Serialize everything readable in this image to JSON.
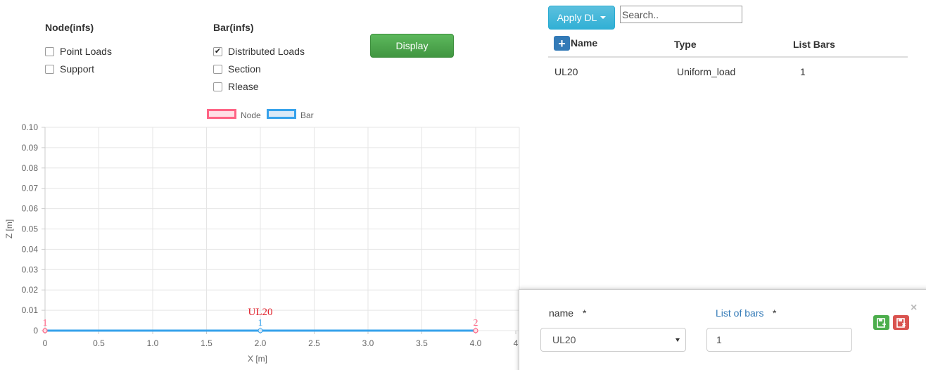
{
  "filters": {
    "node": {
      "title": "Node(infs)",
      "items": [
        {
          "label": "Point Loads",
          "checked": false
        },
        {
          "label": "Support",
          "checked": false
        }
      ]
    },
    "bar": {
      "title": "Bar(infs)",
      "items": [
        {
          "label": "Distributed Loads",
          "checked": true
        },
        {
          "label": "Section",
          "checked": false
        },
        {
          "label": "Rlease",
          "checked": false
        }
      ]
    },
    "display_button": "Display"
  },
  "toolbar": {
    "apply_label": "Apply DL",
    "search_placeholder": "Search.."
  },
  "table": {
    "columns": [
      "Name",
      "Type",
      "List Bars"
    ],
    "rows": [
      {
        "name": "UL20",
        "type": "Uniform_load",
        "list_bars": "1"
      }
    ]
  },
  "chart_data": {
    "type": "scatter",
    "legend": [
      "Node",
      "Bar"
    ],
    "xlabel": "X [m]",
    "ylabel": "Z [m]",
    "xlim": [
      0,
      4
    ],
    "ylim": [
      0,
      0.1
    ],
    "x_ticks": [
      "0",
      "0.5",
      "1.0",
      "1.5",
      "2.0",
      "2.5",
      "3.0",
      "3.5",
      "4.0",
      "4"
    ],
    "y_ticks": [
      "0.10",
      "0.09",
      "0.08",
      "0.07",
      "0.06",
      "0.05",
      "0.04",
      "0.03",
      "0.02",
      "0.01",
      "0"
    ],
    "nodes": [
      {
        "label": "1",
        "x": 0,
        "z": 0
      },
      {
        "label": "2",
        "x": 4.0,
        "z": 0
      }
    ],
    "bars": [
      {
        "label": "1",
        "from": [
          0,
          0
        ],
        "to": [
          4.0,
          0
        ],
        "mid_x": 2.0
      }
    ],
    "annotations": [
      {
        "text": "UL20",
        "x": 2.0,
        "z": 0
      }
    ],
    "colors": {
      "node": "#ff6384",
      "bar": "#36a2eb",
      "load": "#e0202a",
      "grid": "#e5e5e5"
    }
  },
  "editor": {
    "name_label": "name",
    "name_required": "*",
    "list_label": "List of bars",
    "list_required": "*",
    "name_value": "UL20",
    "list_value": "1",
    "close_label": "×"
  }
}
